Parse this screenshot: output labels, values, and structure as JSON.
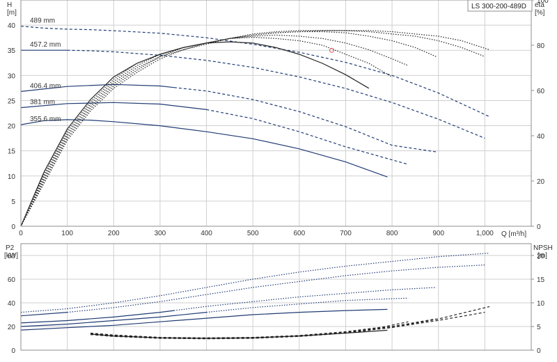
{
  "model_label": "LS 300-200-489D",
  "chart_data": [
    {
      "type": "line",
      "id": "head",
      "left_axis": {
        "title": "H",
        "unit": "[m]",
        "ticks": [
          0,
          5,
          10,
          15,
          20,
          25,
          30,
          35,
          40
        ],
        "ylim": [
          0,
          45
        ]
      },
      "right_axis": {
        "title": "eta",
        "unit": "[%]",
        "ticks": [
          0,
          20,
          40,
          60,
          80,
          100
        ],
        "ylim": [
          0,
          100
        ]
      },
      "x_axis": {
        "title": "Q [m³/h]",
        "ticks": [
          0,
          100,
          200,
          300,
          400,
          500,
          600,
          700,
          800,
          900,
          1000
        ],
        "tick_labels": [
          "0",
          "100",
          "200",
          "300",
          "400",
          "500",
          "600",
          "700",
          "800",
          "900",
          "1,000"
        ],
        "xlim": [
          0,
          1100
        ]
      },
      "grid": true,
      "duty_point": {
        "x": 670,
        "y": 35
      },
      "series": [
        {
          "name": "489 mm",
          "style": "dashed",
          "axis": "left",
          "solid_until": 0,
          "x": [
            0,
            50,
            100,
            150,
            200,
            300,
            400,
            500,
            600,
            700,
            800,
            900,
            1010
          ],
          "y": [
            39.8,
            39.4,
            39.2,
            39.1,
            38.9,
            38.4,
            37.5,
            36.2,
            34.6,
            32.6,
            30.0,
            26.5,
            21.8
          ]
        },
        {
          "name": "457.2 mm",
          "style": "dashed",
          "axis": "left",
          "solid_until": 100,
          "x": [
            0,
            50,
            100,
            150,
            200,
            300,
            400,
            500,
            600,
            700,
            800,
            900,
            1000
          ],
          "y": [
            35.0,
            35.0,
            35.0,
            34.9,
            34.7,
            34.0,
            33.0,
            31.6,
            29.7,
            27.4,
            24.6,
            21.3,
            17.5
          ]
        },
        {
          "name": "406.4 mm",
          "style": "dashed",
          "axis": "left",
          "solid_until": 330,
          "x": [
            0,
            100,
            200,
            300,
            400,
            500,
            600,
            700,
            800,
            895
          ],
          "y": [
            26.8,
            27.8,
            28.2,
            27.9,
            26.9,
            25.2,
            22.8,
            19.8,
            16.1,
            14.8
          ]
        },
        {
          "name": "381 mm",
          "style": "dashed",
          "axis": "left",
          "solid_until": 400,
          "x": [
            0,
            100,
            200,
            300,
            400,
            500,
            600,
            700,
            835
          ],
          "y": [
            23.6,
            24.4,
            24.6,
            24.3,
            23.2,
            21.4,
            18.8,
            15.8,
            12.3
          ]
        },
        {
          "name": "355.6 mm",
          "style": "solid",
          "axis": "left",
          "solid_until": 1100,
          "x": [
            0,
            50,
            100,
            150,
            200,
            300,
            400,
            500,
            600,
            700,
            790
          ],
          "y": [
            20.2,
            21.0,
            21.2,
            21.1,
            20.8,
            20.0,
            18.8,
            17.4,
            15.4,
            12.8,
            9.8
          ]
        },
        {
          "name": "",
          "style": "solid",
          "axis": "right",
          "solid_until": 1100,
          "x": [
            0,
            50,
            100,
            150,
            200,
            250,
            300,
            350,
            400,
            450,
            500,
            550,
            600,
            650,
            700,
            750
          ],
          "y": [
            0,
            24,
            43,
            56,
            66,
            72,
            76,
            79,
            81,
            81.5,
            81,
            79,
            76,
            72,
            67,
            61
          ]
        },
        {
          "name": "",
          "style": "dotted",
          "axis": "right",
          "solid_until": 0,
          "x": [
            0,
            50,
            100,
            150,
            200,
            250,
            300,
            350,
            400,
            450,
            500,
            550,
            600,
            650,
            700,
            750,
            800
          ],
          "y": [
            0,
            23,
            42,
            55,
            65,
            72,
            76,
            79,
            81,
            83,
            83.5,
            83,
            82,
            80,
            76,
            72,
            66
          ]
        },
        {
          "name": "",
          "style": "dotted",
          "axis": "right",
          "solid_until": 0,
          "x": [
            0,
            50,
            100,
            150,
            200,
            250,
            300,
            350,
            400,
            450,
            500,
            550,
            600,
            650,
            700,
            750,
            800,
            835
          ],
          "y": [
            0,
            22,
            41,
            54,
            64,
            71,
            76,
            79,
            81,
            83,
            84,
            84.5,
            84,
            83,
            81,
            78,
            74,
            71
          ]
        },
        {
          "name": "",
          "style": "dotted",
          "axis": "right",
          "solid_until": 0,
          "x": [
            0,
            50,
            100,
            150,
            200,
            250,
            300,
            350,
            400,
            450,
            500,
            550,
            600,
            650,
            700,
            750,
            800,
            850,
            895
          ],
          "y": [
            0,
            21,
            40,
            53,
            63,
            70,
            75,
            79,
            81,
            83,
            84.5,
            85.5,
            86,
            86,
            85.5,
            84,
            82,
            79,
            75
          ]
        },
        {
          "name": "",
          "style": "dotted",
          "axis": "right",
          "solid_until": 0,
          "x": [
            0,
            50,
            100,
            150,
            200,
            250,
            300,
            350,
            400,
            450,
            500,
            550,
            600,
            650,
            700,
            750,
            800,
            850,
            900,
            950,
            1000
          ],
          "y": [
            0,
            20,
            39,
            52,
            62,
            69,
            75,
            78,
            81,
            83,
            85,
            86,
            86.5,
            86.5,
            86.5,
            86,
            85,
            84,
            82,
            79,
            75
          ]
        },
        {
          "name": "",
          "style": "dotted",
          "axis": "right",
          "solid_until": 0,
          "x": [
            0,
            50,
            100,
            150,
            200,
            250,
            300,
            350,
            400,
            450,
            500,
            550,
            600,
            650,
            700,
            750,
            800,
            850,
            900,
            950,
            1010
          ],
          "y": [
            0,
            19,
            38,
            51,
            61,
            68,
            74,
            78,
            80.5,
            83,
            84.5,
            85.5,
            86,
            86.5,
            86.5,
            86.5,
            86,
            85,
            84,
            82,
            78
          ]
        }
      ]
    },
    {
      "type": "line",
      "id": "power-npsh",
      "left_axis": {
        "title": "P2",
        "unit": "[kW]",
        "ticks": [
          0,
          20,
          40,
          60,
          80
        ],
        "ylim": [
          0,
          90
        ]
      },
      "right_axis": {
        "title": "NPSH",
        "unit": "[m]",
        "ticks": [
          0,
          5,
          10,
          15,
          20
        ],
        "ylim": [
          0,
          22.5
        ]
      },
      "x_axis": {
        "ticks": [
          0,
          100,
          200,
          300,
          400,
          500,
          600,
          700,
          800,
          900,
          1000
        ],
        "xlim": [
          0,
          1100
        ]
      },
      "grid": true,
      "series": [
        {
          "name": "",
          "style": "dotted",
          "axis": "left",
          "solid_until": 0,
          "x": [
            0,
            100,
            200,
            300,
            400,
            500,
            600,
            700,
            800,
            900,
            1010
          ],
          "y": [
            32,
            35,
            40,
            46,
            53,
            60,
            66,
            71,
            75,
            79,
            82
          ]
        },
        {
          "name": "",
          "style": "dotted",
          "axis": "left",
          "solid_until": 100,
          "x": [
            0,
            100,
            200,
            300,
            400,
            500,
            600,
            700,
            800,
            900,
            1000
          ],
          "y": [
            29,
            32,
            36,
            41,
            47,
            53,
            58,
            63,
            67,
            70,
            72
          ]
        },
        {
          "name": "",
          "style": "dotted",
          "axis": "left",
          "solid_until": 330,
          "x": [
            0,
            100,
            200,
            300,
            400,
            500,
            600,
            700,
            800,
            895
          ],
          "y": [
            23,
            25,
            28,
            32,
            37,
            41,
            45,
            48,
            51,
            53
          ]
        },
        {
          "name": "",
          "style": "dotted",
          "axis": "left",
          "solid_until": 400,
          "x": [
            0,
            100,
            200,
            300,
            400,
            500,
            600,
            700,
            835
          ],
          "y": [
            20,
            22,
            25,
            28,
            32,
            36,
            39,
            42,
            44
          ]
        },
        {
          "name": "",
          "style": "solid",
          "axis": "left",
          "solid_until": 1100,
          "x": [
            0,
            100,
            200,
            300,
            400,
            500,
            600,
            700,
            790
          ],
          "y": [
            17,
            19,
            21,
            24,
            27,
            30,
            32,
            33.5,
            34.5
          ]
        },
        {
          "name": "",
          "style": "solid",
          "axis": "right",
          "solid_until": 1100,
          "x": [
            150,
            200,
            300,
            400,
            500,
            600,
            700,
            790
          ],
          "y": [
            3.4,
            3.0,
            2.6,
            2.5,
            2.6,
            3.0,
            3.6,
            4.2
          ]
        },
        {
          "name": "",
          "style": "dashed",
          "axis": "right",
          "solid_until": 0,
          "x": [
            150,
            200,
            300,
            400,
            500,
            600,
            700,
            780,
            835
          ],
          "y": [
            3.6,
            3.2,
            2.7,
            2.6,
            2.7,
            3.1,
            3.9,
            4.9,
            6.0
          ]
        },
        {
          "name": "",
          "style": "dashed",
          "axis": "right",
          "solid_until": 0,
          "x": [
            150,
            200,
            300,
            400,
            500,
            600,
            700,
            800,
            895
          ],
          "y": [
            3.5,
            3.1,
            2.6,
            2.5,
            2.6,
            3.0,
            3.8,
            5.0,
            6.6
          ]
        },
        {
          "name": "",
          "style": "dashed",
          "axis": "right",
          "solid_until": 0,
          "x": [
            150,
            200,
            300,
            400,
            500,
            600,
            700,
            800,
            900,
            1000
          ],
          "y": [
            3.4,
            3.0,
            2.6,
            2.5,
            2.6,
            3.0,
            3.7,
            4.8,
            6.3,
            8.0
          ]
        },
        {
          "name": "",
          "style": "dashed",
          "axis": "right",
          "solid_until": 0,
          "x": [
            150,
            200,
            300,
            400,
            500,
            600,
            700,
            800,
            900,
            1010
          ],
          "y": [
            3.3,
            2.9,
            2.5,
            2.4,
            2.5,
            2.9,
            3.6,
            4.8,
            6.6,
            9.2
          ]
        }
      ]
    }
  ],
  "colors": {
    "curve": "#1f3b73",
    "efficiency": "#222222",
    "grid": "#cfcfcf",
    "frame": "#8c8c8c",
    "duty_point": "#e05a5a"
  }
}
